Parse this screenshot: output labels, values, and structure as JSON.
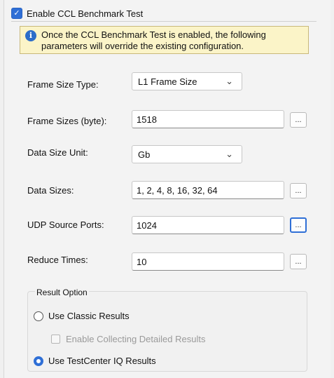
{
  "header": {
    "checkbox_label": "Enable CCL Benchmark Test",
    "checked": true
  },
  "info": {
    "line1": "Once the CCL Benchmark Test is enabled, the following",
    "line2": "parameters will override the existing configuration."
  },
  "fields": {
    "frame_size_type": {
      "label": "Frame Size Type:",
      "value": "L1 Frame Size"
    },
    "frame_sizes": {
      "label": "Frame Sizes (byte):",
      "value": "1518",
      "button": "..."
    },
    "data_size_unit": {
      "label": "Data Size Unit:",
      "value": "Gb"
    },
    "data_sizes": {
      "label": "Data Sizes:",
      "value": "1, 2, 4, 8, 16, 32, 64",
      "button": "..."
    },
    "udp_source_ports": {
      "label": "UDP Source Ports:",
      "value": "1024",
      "button": "..."
    },
    "reduce_times": {
      "label": "Reduce Times:",
      "value": "10",
      "button": "..."
    }
  },
  "result_option": {
    "title": "Result Option",
    "classic": {
      "label": "Use Classic Results",
      "selected": false
    },
    "detailed": {
      "label": "Enable Collecting Detailed Results",
      "checked": false,
      "enabled": false
    },
    "iq": {
      "label": "Use TestCenter IQ Results",
      "selected": true
    }
  },
  "icons": {
    "dropdown": "chevron-down-icon",
    "info": "info-icon",
    "checkmark": "checkmark-icon"
  },
  "colors": {
    "accent": "#2f6fd6",
    "info_background": "#fbf4c8",
    "info_border": "#c8b87a"
  }
}
